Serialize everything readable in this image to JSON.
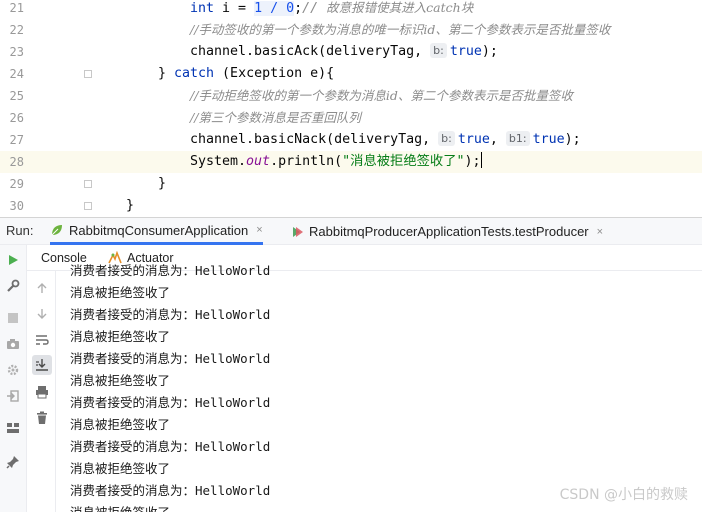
{
  "editor": {
    "lines": [
      {
        "num": "21",
        "indent": 190,
        "tokens": [
          {
            "t": "int",
            "c": "kw"
          },
          {
            "t": " i = "
          },
          {
            "t": "1",
            "c": "num"
          },
          {
            "t": " / ",
            "c": "num"
          },
          {
            "t": "0",
            "c": "num"
          },
          {
            "t": ";"
          },
          {
            "t": "// ",
            "c": "cmt"
          },
          {
            "t": "故意报错使其进入catch块",
            "c": "cmt-zh"
          }
        ]
      },
      {
        "num": "22",
        "indent": 190,
        "tokens": [
          {
            "t": "//手动签收的第一个参数为消息的唯一标识id、第二个参数表示是否批量签收",
            "c": "cmt-zh"
          }
        ]
      },
      {
        "num": "23",
        "indent": 190,
        "tokens": [
          {
            "t": "channel.basicAck(deliveryTag, "
          },
          {
            "t": "b:",
            "c": "hint"
          },
          {
            "t": "true",
            "c": "kw"
          },
          {
            "t": ");"
          }
        ]
      },
      {
        "num": "24",
        "indent": 158,
        "fold": true,
        "tokens": [
          {
            "t": "} "
          },
          {
            "t": "catch",
            "c": "kw"
          },
          {
            "t": " (Exception e){"
          }
        ]
      },
      {
        "num": "25",
        "indent": 190,
        "tokens": [
          {
            "t": "//手动拒绝签收的第一个参数为消息id、第二个参数表示是否批量签收",
            "c": "cmt-zh"
          }
        ]
      },
      {
        "num": "26",
        "indent": 190,
        "tokens": [
          {
            "t": "//第三个参数消息是否重回队列",
            "c": "cmt-zh"
          }
        ]
      },
      {
        "num": "27",
        "indent": 190,
        "tokens": [
          {
            "t": "channel.basicNack(deliveryTag, "
          },
          {
            "t": "b:",
            "c": "hint"
          },
          {
            "t": "true",
            "c": "kw"
          },
          {
            "t": ", "
          },
          {
            "t": "b1:",
            "c": "hint"
          },
          {
            "t": "true",
            "c": "kw"
          },
          {
            "t": ");"
          }
        ]
      },
      {
        "num": "28",
        "indent": 190,
        "current": true,
        "tokens": [
          {
            "t": "System."
          },
          {
            "t": "out",
            "c": "fld"
          },
          {
            "t": ".println("
          },
          {
            "t": "\"消息被拒绝签收了\"",
            "c": "str"
          },
          {
            "t": ");"
          },
          {
            "t": "",
            "c": "caret"
          }
        ]
      },
      {
        "num": "29",
        "indent": 158,
        "fold": true,
        "tokens": [
          {
            "t": "}"
          }
        ]
      },
      {
        "num": "30",
        "indent": 126,
        "fold": true,
        "tokens": [
          {
            "t": "}"
          }
        ]
      }
    ]
  },
  "run_bar": {
    "label": "Run:",
    "tabs": [
      {
        "label": "RabbitmqConsumerApplication",
        "close": "×",
        "active": true,
        "icon": "spring-leaf-icon"
      },
      {
        "label": "RabbitmqProducerApplicationTests.testProducer",
        "close": "×",
        "active": false,
        "icon": "test-run-icon"
      }
    ]
  },
  "console_header": {
    "tabs": [
      {
        "label": "Console",
        "icon": ""
      },
      {
        "label": "Actuator",
        "icon": "actuator-icon"
      }
    ]
  },
  "console": {
    "lines": [
      "消费者接受的消息为：HelloWorld",
      "消息被拒绝签收了",
      "消费者接受的消息为：HelloWorld",
      "消息被拒绝签收了",
      "消费者接受的消息为：HelloWorld",
      "消息被拒绝签收了",
      "消费者接受的消息为：HelloWorld",
      "消息被拒绝签收了",
      "消费者接受的消息为：HelloWorld",
      "消息被拒绝签收了",
      "消费者接受的消息为：HelloWorld",
      "消息被拒绝签收了"
    ]
  },
  "watermark": "CSDN @小白的救赎",
  "colors": {
    "keyword": "#0033b3",
    "string": "#067d17",
    "comment": "#8c8c8c",
    "run_icon": "#4caf50",
    "accent": "#3574f0"
  }
}
